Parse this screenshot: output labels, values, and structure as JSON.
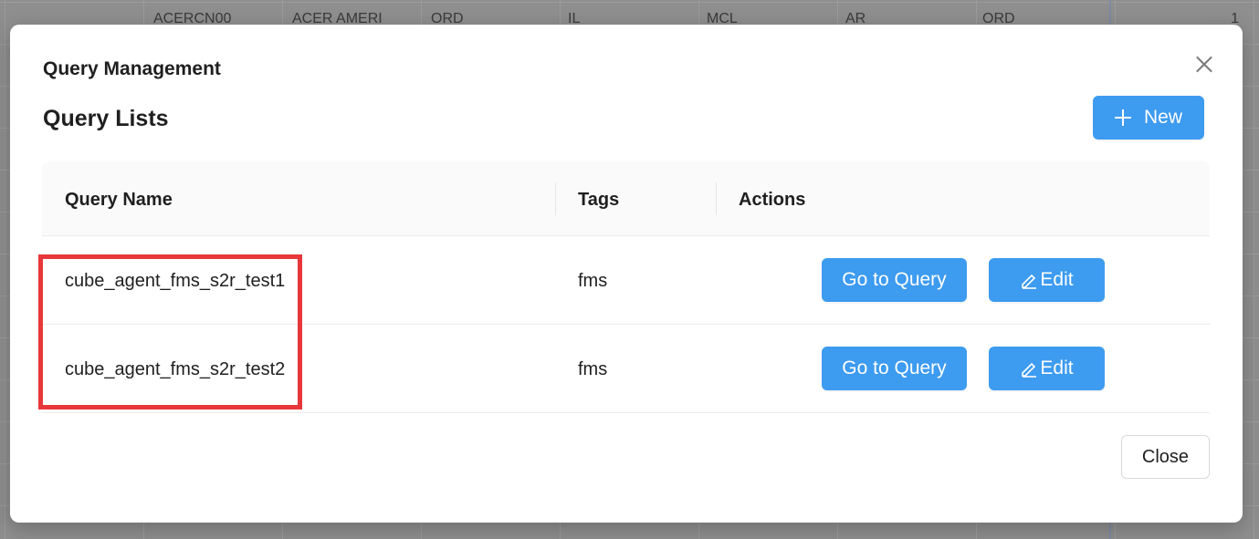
{
  "background": {
    "row": [
      "ACERCN00",
      "ACER AMERI",
      "ORD",
      "IL",
      "MCL",
      "AR",
      "ORD"
    ],
    "row_number": "1"
  },
  "modal": {
    "title": "Query Management",
    "section_title": "Query Lists",
    "new_button_label": "New",
    "close_button_label": "Close"
  },
  "table": {
    "headers": [
      "Query Name",
      "Tags",
      "Actions"
    ],
    "rows": [
      {
        "name": "cube_agent_fms_s2r_test1",
        "tags": "fms",
        "go_label": "Go to Query",
        "edit_label": "Edit"
      },
      {
        "name": "cube_agent_fms_s2r_test2",
        "tags": "fms",
        "go_label": "Go to Query",
        "edit_label": "Edit"
      }
    ]
  },
  "colors": {
    "primary": "#3d9bf0",
    "highlight": "#e8373a"
  }
}
